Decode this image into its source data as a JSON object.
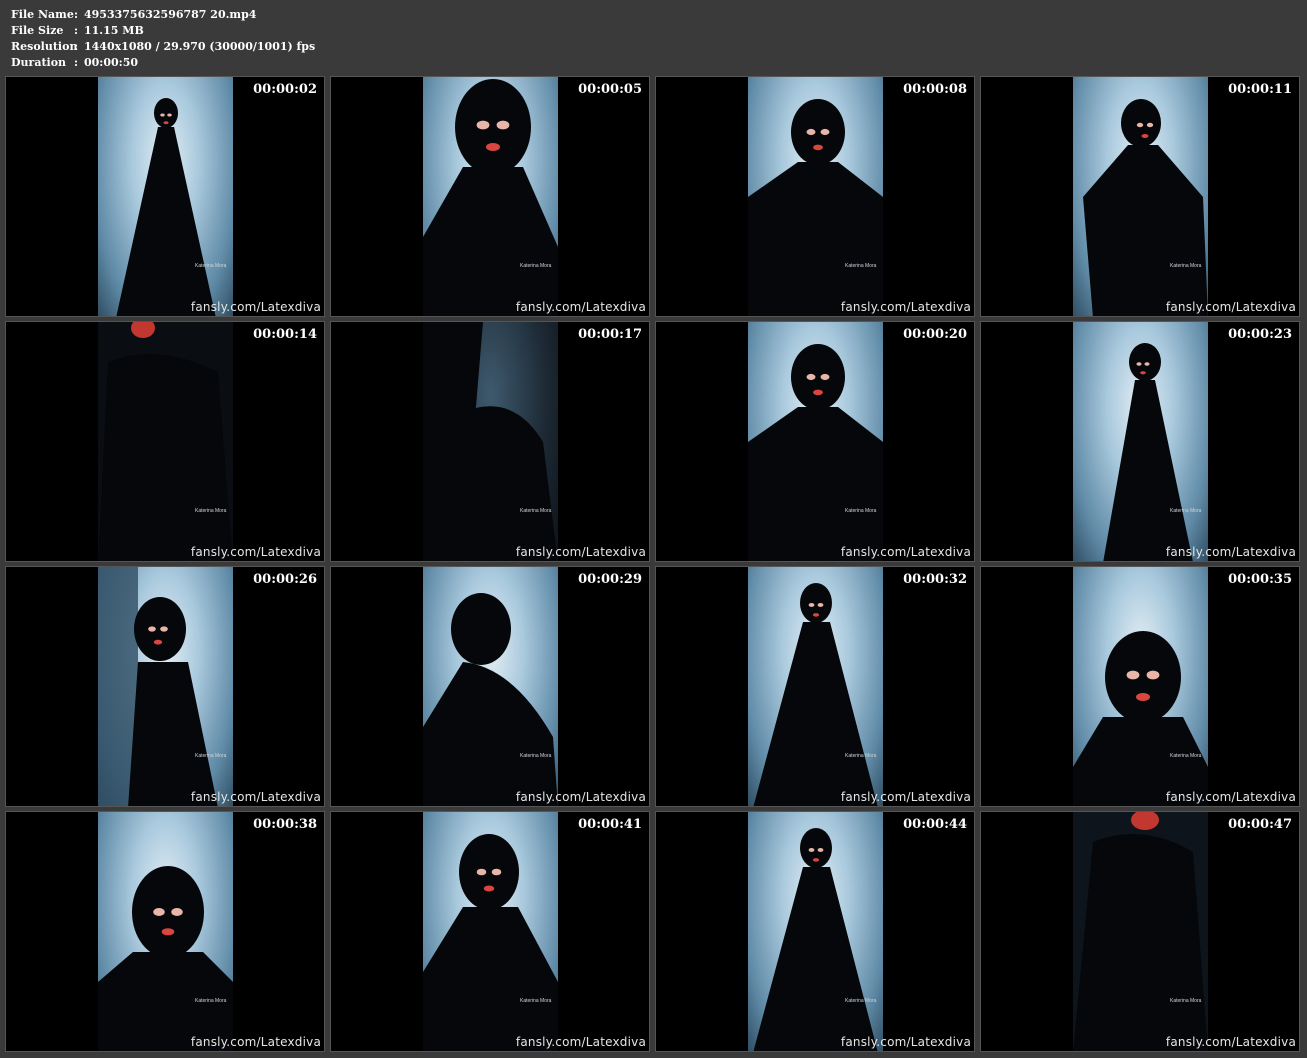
{
  "header": {
    "file_name": {
      "key": "File Name",
      "value": "4953375632596787 20.mp4"
    },
    "file_size": {
      "key": "File Size",
      "value": "11.15 MB"
    },
    "resolution": {
      "key": "Resolution",
      "value": "1440x1080 / 29.970 (30000/1001) fps"
    },
    "duration": {
      "key": "Duration",
      "value": "00:00:50"
    },
    "separator": ":"
  },
  "watermark": "fansly.com/Latexdiva",
  "signature": "Katerina Mora",
  "thumbnails": [
    {
      "time": "00:00:02"
    },
    {
      "time": "00:00:05"
    },
    {
      "time": "00:00:08"
    },
    {
      "time": "00:00:11"
    },
    {
      "time": "00:00:14"
    },
    {
      "time": "00:00:17"
    },
    {
      "time": "00:00:20"
    },
    {
      "time": "00:00:23"
    },
    {
      "time": "00:00:26"
    },
    {
      "time": "00:00:29"
    },
    {
      "time": "00:00:32"
    },
    {
      "time": "00:00:35"
    },
    {
      "time": "00:00:38"
    },
    {
      "time": "00:00:41"
    },
    {
      "time": "00:00:44"
    },
    {
      "time": "00:00:47"
    }
  ],
  "colors": {
    "background": "#3a3a3a",
    "frame": "#000000",
    "sky": "#a9c9dd"
  }
}
